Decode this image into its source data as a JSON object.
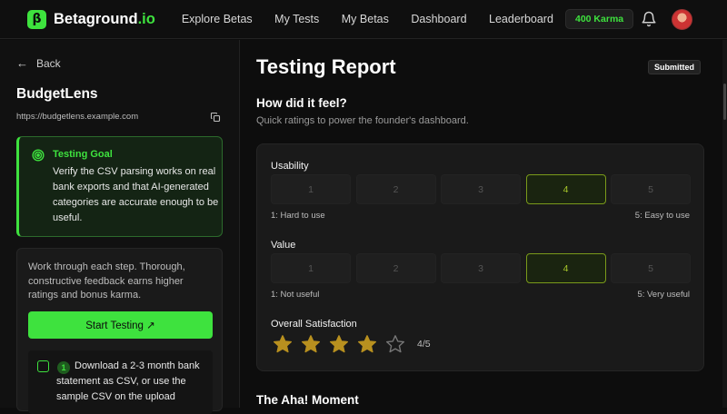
{
  "app": {
    "logo_glyph": "β",
    "logo_name": "Betaground",
    "logo_tld": ".io",
    "accent_color": "#3ee23e"
  },
  "nav": {
    "items": [
      {
        "label": "Explore Betas"
      },
      {
        "label": "My Tests"
      },
      {
        "label": "My Betas"
      },
      {
        "label": "Dashboard"
      },
      {
        "label": "Leaderboard"
      }
    ],
    "karma": "400 Karma",
    "bell_icon": "bell-icon",
    "avatar_icon": "avatar"
  },
  "sidebar": {
    "back_label": "Back",
    "project_name": "BudgetLens",
    "project_url": "https://budgetlens.example.com",
    "goal": {
      "title": "Testing Goal",
      "body": "Verify the CSV parsing works on real bank exports and that AI-generated categories are accurate enough to be useful."
    },
    "work": {
      "text": "Work through each step. Thorough, constructive feedback earns higher ratings and bonus karma.",
      "start_button": "Start Testing ↗",
      "step": {
        "number": "1",
        "text": "Download a 2-3 month bank statement as CSV, or use the sample CSV on the upload"
      }
    }
  },
  "main": {
    "title": "Testing Report",
    "status_badge": "Submitted",
    "feel_heading": "How did it feel?",
    "feel_sub": "Quick ratings to power the founder's dashboard.",
    "usability": {
      "label": "Usability",
      "options": [
        "1",
        "2",
        "3",
        "4",
        "5"
      ],
      "selected": 4,
      "low_hint": "1: Hard to use",
      "high_hint": "5: Easy to use"
    },
    "value": {
      "label": "Value",
      "options": [
        "1",
        "2",
        "3",
        "4",
        "5"
      ],
      "selected": 4,
      "low_hint": "1: Not useful",
      "high_hint": "5: Very useful"
    },
    "satisfaction": {
      "label": "Overall Satisfaction",
      "rating": 4,
      "max": 5,
      "display": "4/5"
    },
    "aha_heading": "The Aha! Moment"
  }
}
